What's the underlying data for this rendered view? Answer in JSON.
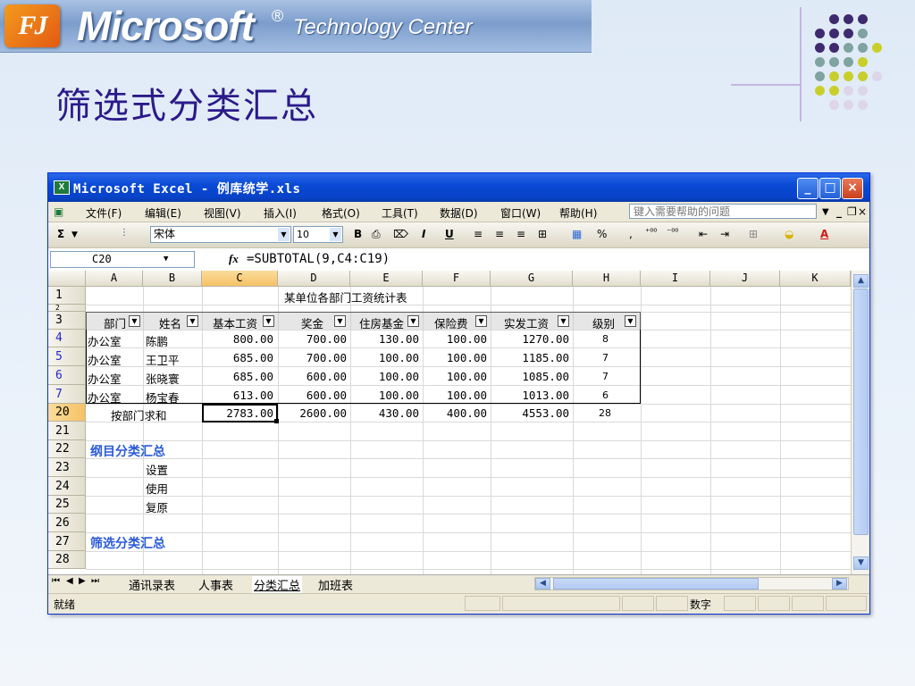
{
  "banner": {
    "logo_text": "FJ",
    "brand": "Microsoft",
    "registered": "®",
    "subtitle": "Technology Center"
  },
  "slide": {
    "title": "筛选式分类汇总"
  },
  "colors": {
    "title": "#2b1a8a",
    "accent_blue": "#2a5bd7",
    "selected_header": "#f5c266"
  },
  "excel": {
    "window_title": "Microsoft Excel - 例库统学.xls",
    "window_buttons": [
      "_",
      "□",
      "×"
    ],
    "menu": [
      "文件(F)",
      "编辑(E)",
      "视图(V)",
      "插入(I)",
      "格式(O)",
      "工具(T)",
      "数据(D)",
      "窗口(W)",
      "帮助(H)"
    ],
    "help_placeholder": "键入需要帮助的问题",
    "toolbar": {
      "sigma": "Σ",
      "font": "宋体",
      "font_size": "10",
      "bold": "B",
      "italic": "I",
      "underline": "U",
      "percent": "%"
    },
    "name_box": "C20",
    "formula": "=SUBTOTAL(9,C4:C19)",
    "columns": [
      "A",
      "B",
      "C",
      "D",
      "E",
      "F",
      "G",
      "H",
      "I",
      "J",
      "K"
    ],
    "selected_column": "C",
    "table_title": "某单位各部门工资统计表",
    "headers": [
      "部门",
      "姓名",
      "基本工资",
      "奖金",
      "住房基金",
      "保险费",
      "实发工资",
      "级别"
    ],
    "rows": [
      {
        "row": "4",
        "dept": "办公室",
        "name": "陈鹏",
        "base": "800.00",
        "bonus": "700.00",
        "housing": "130.00",
        "insurance": "100.00",
        "net": "1270.00",
        "level": "8"
      },
      {
        "row": "5",
        "dept": "办公室",
        "name": "王卫平",
        "base": "685.00",
        "bonus": "700.00",
        "housing": "100.00",
        "insurance": "100.00",
        "net": "1185.00",
        "level": "7"
      },
      {
        "row": "6",
        "dept": "办公室",
        "name": "张晓寰",
        "base": "685.00",
        "bonus": "600.00",
        "housing": "100.00",
        "insurance": "100.00",
        "net": "1085.00",
        "level": "7"
      },
      {
        "row": "7",
        "dept": "办公室",
        "name": "杨宝春",
        "base": "613.00",
        "bonus": "600.00",
        "housing": "100.00",
        "insurance": "100.00",
        "net": "1013.00",
        "level": "6"
      }
    ],
    "summary": {
      "row": "20",
      "label": "按部门求和",
      "base": "2783.00",
      "bonus": "2600.00",
      "housing": "430.00",
      "insurance": "400.00",
      "net": "4553.00",
      "level": "28"
    },
    "row_numbers": [
      "1",
      "2",
      "3",
      "4",
      "5",
      "6",
      "7",
      "20",
      "21",
      "22",
      "23",
      "24",
      "25",
      "26",
      "27",
      "28"
    ],
    "notes": {
      "r22": "纲目分类汇总",
      "r23": "设置",
      "r24": "使用",
      "r25": "复原",
      "r27": "筛选分类汇总"
    },
    "sheet_tabs": [
      "通讯录表",
      "人事表",
      "分类汇总",
      "加班表"
    ],
    "active_sheet": "分类汇总",
    "status_left": "就绪",
    "status_mode": "数字"
  }
}
